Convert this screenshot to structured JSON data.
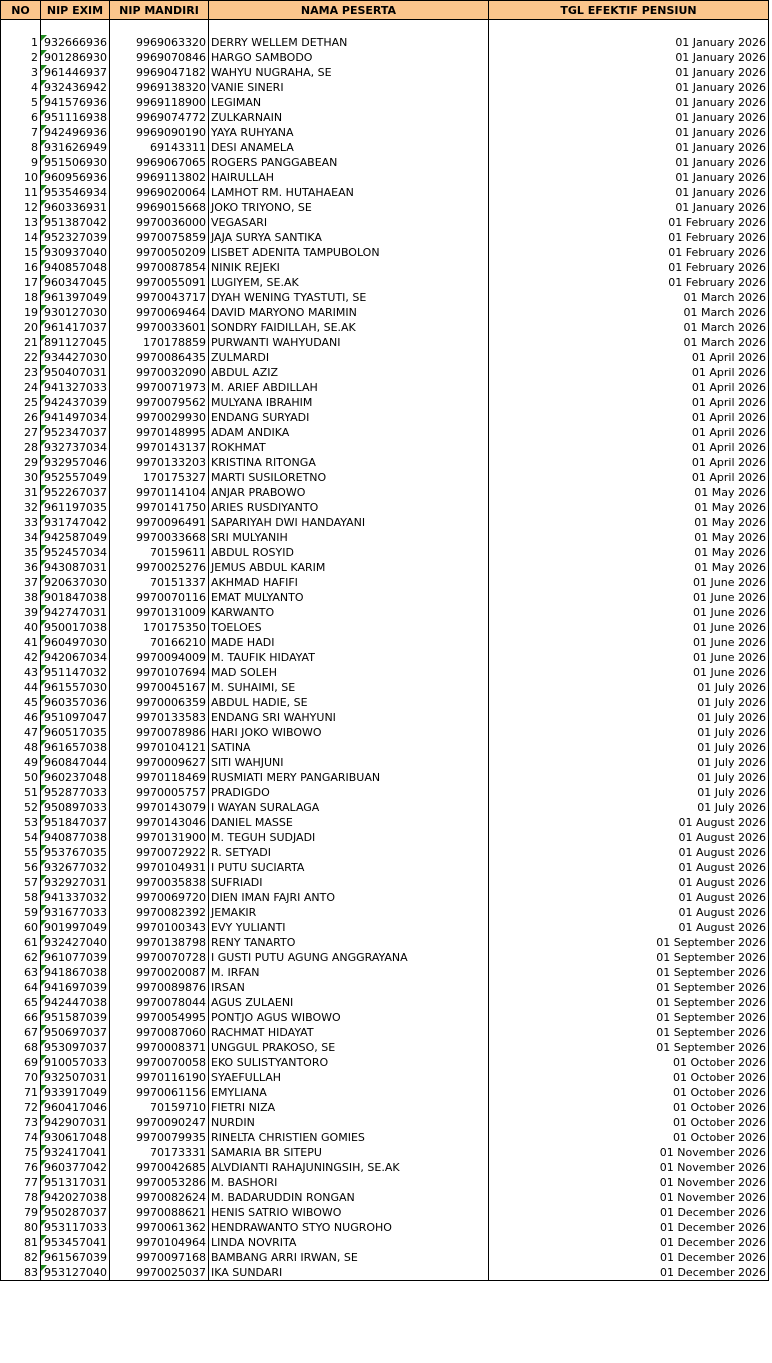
{
  "headers": {
    "no": "NO",
    "nip_exim": "NIP EXIM",
    "nip_mandiri": "NIP MANDIRI",
    "nama": "NAMA PESERTA",
    "tgl": "TGL EFEKTIF PENSIUN"
  },
  "colors": {
    "header_bg": "#fbc58c",
    "marker": "#1f8a1f"
  },
  "rows": [
    [
      "1",
      "932666936",
      "9969063320",
      "DERRY WELLEM DETHAN",
      "01 January 2026"
    ],
    [
      "2",
      "901286930",
      "9969070846",
      "HARGO SAMBODO",
      "01 January 2026"
    ],
    [
      "3",
      "961446937",
      "9969047182",
      "WAHYU NUGRAHA, SE",
      "01 January 2026"
    ],
    [
      "4",
      "932436942",
      "9969138320",
      "VANIE SINERI",
      "01 January 2026"
    ],
    [
      "5",
      "941576936",
      "9969118900",
      "LEGIMAN",
      "01 January 2026"
    ],
    [
      "6",
      "951116938",
      "9969074772",
      "ZULKARNAIN",
      "01 January 2026"
    ],
    [
      "7",
      "942496936",
      "9969090190",
      "YAYA RUHYANA",
      "01 January 2026"
    ],
    [
      "8",
      "931626949",
      "69143311",
      "DESI ANAMELA",
      "01 January 2026"
    ],
    [
      "9",
      "951506930",
      "9969067065",
      "ROGERS PANGGABEAN",
      "01 January 2026"
    ],
    [
      "10",
      "960956936",
      "9969113802",
      "HAIRULLAH",
      "01 January 2026"
    ],
    [
      "11",
      "953546934",
      "9969020064",
      "LAMHOT RM. HUTAHAEAN",
      "01 January 2026"
    ],
    [
      "12",
      "960336931",
      "9969015668",
      "JOKO TRIYONO, SE",
      "01 January 2026"
    ],
    [
      "13",
      "951387042",
      "9970036000",
      "VEGASARI",
      "01 February 2026"
    ],
    [
      "14",
      "952327039",
      "9970075859",
      "JAJA SURYA SANTIKA",
      "01 February 2026"
    ],
    [
      "15",
      "930937040",
      "9970050209",
      "LISBET ADENITA TAMPUBOLON",
      "01 February 2026"
    ],
    [
      "16",
      "940857048",
      "9970087854",
      "NINIK REJEKI",
      "01 February 2026"
    ],
    [
      "17",
      "960347045",
      "9970055091",
      "LUGIYEM, SE.AK",
      "01 February 2026"
    ],
    [
      "18",
      "961397049",
      "9970043717",
      "DYAH WENING TYASTUTI, SE",
      "01 March 2026"
    ],
    [
      "19",
      "930127030",
      "9970069464",
      "DAVID MARYONO MARIMIN",
      "01 March 2026"
    ],
    [
      "20",
      "961417037",
      "9970033601",
      "SONDRY FAIDILLAH, SE.AK",
      "01 March 2026"
    ],
    [
      "21",
      "891127045",
      "170178859",
      "PURWANTI WAHYUDANI",
      "01 March 2026"
    ],
    [
      "22",
      "934427030",
      "9970086435",
      "ZULMARDI",
      "01 April 2026"
    ],
    [
      "23",
      "950407031",
      "9970032090",
      "ABDUL AZIZ",
      "01 April 2026"
    ],
    [
      "24",
      "941327033",
      "9970071973",
      "M. ARIEF ABDILLAH",
      "01 April 2026"
    ],
    [
      "25",
      "942437039",
      "9970079562",
      "MULYANA IBRAHIM",
      "01 April 2026"
    ],
    [
      "26",
      "941497034",
      "9970029930",
      "ENDANG SURYADI",
      "01 April 2026"
    ],
    [
      "27",
      "952347037",
      "9970148995",
      "ADAM ANDIKA",
      "01 April 2026"
    ],
    [
      "28",
      "932737034",
      "9970143137",
      "ROKHMAT",
      "01 April 2026"
    ],
    [
      "29",
      "932957046",
      "9970133203",
      "KRISTINA RITONGA",
      "01 April 2026"
    ],
    [
      "30",
      "952557049",
      "170175327",
      "MARTI SUSILORETNO",
      "01 April 2026"
    ],
    [
      "31",
      "952267037",
      "9970114104",
      "ANJAR PRABOWO",
      "01 May 2026"
    ],
    [
      "32",
      "961197035",
      "9970141750",
      "ARIES RUSDIYANTO",
      "01 May 2026"
    ],
    [
      "33",
      "931747042",
      "9970096491",
      "SAPARIYAH DWI HANDAYANI",
      "01 May 2026"
    ],
    [
      "34",
      "942587049",
      "9970033668",
      "SRI MULYANIH",
      "01 May 2026"
    ],
    [
      "35",
      "952457034",
      "70159611",
      "ABDUL ROSYID",
      "01 May 2026"
    ],
    [
      "36",
      "943087031",
      "9970025276",
      "JEMUS ABDUL KARIM",
      "01 May 2026"
    ],
    [
      "37",
      "920637030",
      "70151337",
      "AKHMAD HAFIFI",
      "01 June 2026"
    ],
    [
      "38",
      "901847038",
      "9970070116",
      "EMAT MULYANTO",
      "01 June 2026"
    ],
    [
      "39",
      "942747031",
      "9970131009",
      "KARWANTO",
      "01 June 2026"
    ],
    [
      "40",
      "950017038",
      "170175350",
      "TOELOES",
      "01 June 2026"
    ],
    [
      "41",
      "960497030",
      "70166210",
      "MADE HADI",
      "01 June 2026"
    ],
    [
      "42",
      "942067034",
      "9970094009",
      "M. TAUFIK HIDAYAT",
      "01 June 2026"
    ],
    [
      "43",
      "951147032",
      "9970107694",
      "MAD SOLEH",
      "01 June 2026"
    ],
    [
      "44",
      "961557030",
      "9970045167",
      "M. SUHAIMI, SE",
      "01 July 2026"
    ],
    [
      "45",
      "960357036",
      "9970006359",
      "ABDUL HADIE, SE",
      "01 July 2026"
    ],
    [
      "46",
      "951097047",
      "9970133583",
      "ENDANG SRI WAHYUNI",
      "01 July 2026"
    ],
    [
      "47",
      "960517035",
      "9970078986",
      "HARI JOKO WIBOWO",
      "01 July 2026"
    ],
    [
      "48",
      "961657038",
      "9970104121",
      "SATINA",
      "01 July 2026"
    ],
    [
      "49",
      "960847044",
      "9970009627",
      "SITI WAHJUNI",
      "01 July 2026"
    ],
    [
      "50",
      "960237048",
      "9970118469",
      "RUSMIATI MERY PANGARIBUAN",
      "01 July 2026"
    ],
    [
      "51",
      "952877033",
      "9970005757",
      "PRADIGDO",
      "01 July 2026"
    ],
    [
      "52",
      "950897033",
      "9970143079",
      "I WAYAN SURALAGA",
      "01 July 2026"
    ],
    [
      "53",
      "951847037",
      "9970143046",
      "DANIEL MASSE",
      "01 August 2026"
    ],
    [
      "54",
      "940877038",
      "9970131900",
      "M. TEGUH SUDJADI",
      "01 August 2026"
    ],
    [
      "55",
      "953767035",
      "9970072922",
      "R. SETYADI",
      "01 August 2026"
    ],
    [
      "56",
      "932677032",
      "9970104931",
      "I PUTU SUCIARTA",
      "01 August 2026"
    ],
    [
      "57",
      "932927031",
      "9970035838",
      "SUFRIADI",
      "01 August 2026"
    ],
    [
      "58",
      "941337032",
      "9970069720",
      "DIEN IMAN FAJRI ANTO",
      "01 August 2026"
    ],
    [
      "59",
      "931677033",
      "9970082392",
      "JEMAKIR",
      "01 August 2026"
    ],
    [
      "60",
      "901997049",
      "9970100343",
      "EVY YULIANTI",
      "01 August 2026"
    ],
    [
      "61",
      "932427040",
      "9970138798",
      "RENY TANARTO",
      "01 September 2026"
    ],
    [
      "62",
      "961077039",
      "9970070728",
      "I GUSTI PUTU AGUNG ANGGRAYANA",
      "01 September 2026"
    ],
    [
      "63",
      "941867038",
      "9970020087",
      "M. IRFAN",
      "01 September 2026"
    ],
    [
      "64",
      "941697039",
      "9970089876",
      "IRSAN",
      "01 September 2026"
    ],
    [
      "65",
      "942447038",
      "9970078044",
      "AGUS ZULAENI",
      "01 September 2026"
    ],
    [
      "66",
      "951587039",
      "9970054995",
      "PONTJO AGUS WIBOWO",
      "01 September 2026"
    ],
    [
      "67",
      "950697037",
      "9970087060",
      "RACHMAT HIDAYAT",
      "01 September 2026"
    ],
    [
      "68",
      "953097037",
      "9970008371",
      "UNGGUL PRAKOSO, SE",
      "01 September 2026"
    ],
    [
      "69",
      "910057033",
      "9970070058",
      "EKO SULISTYANTORO",
      "01 October 2026"
    ],
    [
      "70",
      "932507031",
      "9970116190",
      "SYAEFULLAH",
      "01 October 2026"
    ],
    [
      "71",
      "933917049",
      "9970061156",
      "EMYLIANA",
      "01 October 2026"
    ],
    [
      "72",
      "960417046",
      "70159710",
      "FIETRI NIZA",
      "01 October 2026"
    ],
    [
      "73",
      "942907031",
      "9970090247",
      "NURDIN",
      "01 October 2026"
    ],
    [
      "74",
      "930617048",
      "9970079935",
      "RINELTA CHRISTIEN GOMIES",
      "01 October 2026"
    ],
    [
      "75",
      "932417041",
      "70173331",
      "SAMARIA BR SITEPU",
      "01 November 2026"
    ],
    [
      "76",
      "960377042",
      "9970042685",
      "ALVDIANTI RAHAJUNINGSIH, SE.AK",
      "01 November 2026"
    ],
    [
      "77",
      "951317031",
      "9970053286",
      "M. BASHORI",
      "01 November 2026"
    ],
    [
      "78",
      "942027038",
      "9970082624",
      "M. BADARUDDIN RONGAN",
      "01 November 2026"
    ],
    [
      "79",
      "950287037",
      "9970088621",
      "HENIS SATRIO WIBOWO",
      "01 December 2026"
    ],
    [
      "80",
      "953117033",
      "9970061362",
      "HENDRAWANTO STYO NUGROHO",
      "01 December 2026"
    ],
    [
      "81",
      "953457041",
      "9970104964",
      "LINDA NOVRITA",
      "01 December 2026"
    ],
    [
      "82",
      "961567039",
      "9970097168",
      "BAMBANG ARRI IRWAN, SE",
      "01 December 2026"
    ],
    [
      "83",
      "953127040",
      "9970025037",
      "IKA SUNDARI",
      "01 December 2026"
    ]
  ]
}
